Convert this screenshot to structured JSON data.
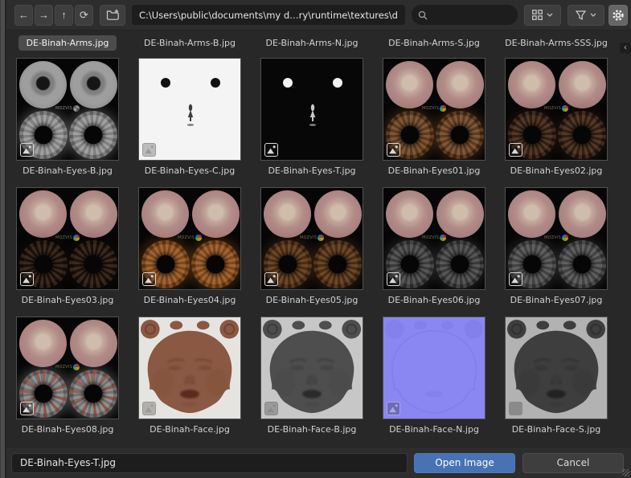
{
  "toolbar": {
    "icons": {
      "back": "←",
      "forward": "→",
      "up": "↑",
      "refresh": "⟳"
    },
    "path_value": "C:\\Users\\public\\documents\\my d…ry\\runtime\\textures\\darkelf\\binah\\",
    "search_value": ""
  },
  "sidebar_toggle": {
    "icon": "‹"
  },
  "colors": {
    "accent_blue": "#4772b3",
    "selection_gray": "#4c4c4c",
    "header_bg": "#2d2d2d",
    "content_bg": "#282828",
    "field_bg": "#1d1d1d",
    "normal_map_lavender": "#8a87f3"
  },
  "grid": {
    "watermark": "MOZVIS",
    "header_row": {
      "items": [
        {
          "label": "DE-Binah-Arms.jpg",
          "selected": true
        },
        {
          "label": "DE-Binah-Arms-B.jpg",
          "selected": false
        },
        {
          "label": "DE-Binah-Arms-N.jpg",
          "selected": false
        },
        {
          "label": "DE-Binah-Arms-S.jpg",
          "selected": false
        },
        {
          "label": "DE-Binah-Arms-SSS.jpg",
          "selected": false
        }
      ]
    },
    "rows": [
      {
        "tiles": [
          {
            "label": "DE-Binah-Eyes-B.jpg",
            "thumb": {
              "kind": "eyes",
              "disc": "gray",
              "ring": "#969696",
              "ring2": "#6e6e6e",
              "logo": "gray",
              "glow": "rgba(200,200,200,0.28)"
            }
          },
          {
            "label": "DE-Binah-Eyes-C.jpg",
            "thumb": {
              "kind": "dots",
              "bg": "#f4f4f4",
              "dot": "#101010",
              "fig": "#3c3c3c",
              "overlay": "#9a9a9a"
            }
          },
          {
            "label": "DE-Binah-Eyes-T.jpg",
            "thumb": {
              "kind": "dots",
              "bg": "#070707",
              "dot": "#f2f2f2",
              "fig": "#c8c8c8"
            }
          },
          {
            "label": "DE-Binah-Eyes01.jpg",
            "thumb": {
              "kind": "eyes",
              "disc": "pink",
              "ring": "#6e4523",
              "ring2": "#46270e",
              "logo": "color",
              "glow": "rgba(150,90,40,0.3)"
            }
          },
          {
            "label": "DE-Binah-Eyes02.jpg",
            "thumb": {
              "kind": "eyes",
              "disc": "pink",
              "ring": "#3c2414",
              "ring2": "#27140a",
              "logo": "color",
              "glow": "rgba(70,45,25,0.25)"
            }
          }
        ]
      },
      {
        "tiles": [
          {
            "label": "DE-Binah-Eyes03.jpg",
            "thumb": {
              "kind": "eyes",
              "disc": "pink",
              "ring": "#231309",
              "ring2": "#170c05",
              "logo": "color",
              "glow": "rgba(40,25,15,0.2)"
            }
          },
          {
            "label": "DE-Binah-Eyes04.jpg",
            "thumb": {
              "kind": "eyes",
              "disc": "pink",
              "ring": "#95541f",
              "ring2": "#6b3810",
              "logo": "color",
              "glow": "rgba(190,110,40,0.3)"
            }
          },
          {
            "label": "DE-Binah-Eyes05.jpg",
            "thumb": {
              "kind": "eyes",
              "disc": "pink",
              "ring": "#5a3414",
              "ring2": "#3e220c",
              "logo": "color",
              "glow": "rgba(140,85,35,0.25)"
            }
          },
          {
            "label": "DE-Binah-Eyes06.jpg",
            "thumb": {
              "kind": "eyes",
              "disc": "pink",
              "ring": "#454545",
              "ring2": "#2e2e2e",
              "logo": "color",
              "glow": "rgba(130,130,130,0.2)"
            }
          },
          {
            "label": "DE-Binah-Eyes07.jpg",
            "thumb": {
              "kind": "eyes",
              "disc": "pink",
              "ring": "#4e4e4e",
              "ring2": "#363636",
              "logo": "color",
              "glow": "rgba(140,140,140,0.2)"
            }
          }
        ]
      },
      {
        "tiles": [
          {
            "label": "DE-Binah-Eyes08.jpg",
            "thumb": {
              "kind": "eyes",
              "disc": "pink",
              "ring": "#868686",
              "ring2": "#5f5f5f",
              "fleck": "rgba(164,60,36,0.6)",
              "logo": "color",
              "glow": "rgba(190,190,190,0.3)"
            }
          },
          {
            "label": "DE-Binah-Face.jpg",
            "thumb": {
              "kind": "face",
              "bg": "#e6e4e1",
              "skin": "#8a5843",
              "skin2": "#6f4331",
              "lip": "#5a2a1c",
              "overlay": "#9a9a9a"
            }
          },
          {
            "label": "DE-Binah-Face-B.jpg",
            "thumb": {
              "kind": "face",
              "bg": "#c7c7c7",
              "skin": "#4e4e4e",
              "skin2": "#3c3c3c",
              "lip": "#2c2c2c",
              "overlay": "#8a8a8a"
            }
          },
          {
            "label": "DE-Binah-Face-N.jpg",
            "thumb": {
              "kind": "flat",
              "bg": "#8a87f3",
              "feature": "#7f7ce6",
              "overlay": "#aaa8da"
            }
          },
          {
            "label": "DE-Binah-Face-S.jpg",
            "thumb": {
              "kind": "face",
              "bg": "#b2b2b2",
              "skin": "#3e3e3e",
              "skin2": "#303030",
              "lip": "#222222",
              "overlay": "#8a8a8a"
            }
          }
        ]
      }
    ]
  },
  "footer": {
    "filename_value": "DE-Binah-Eyes-T.jpg",
    "open_label": "Open Image",
    "cancel_label": "Cancel"
  }
}
